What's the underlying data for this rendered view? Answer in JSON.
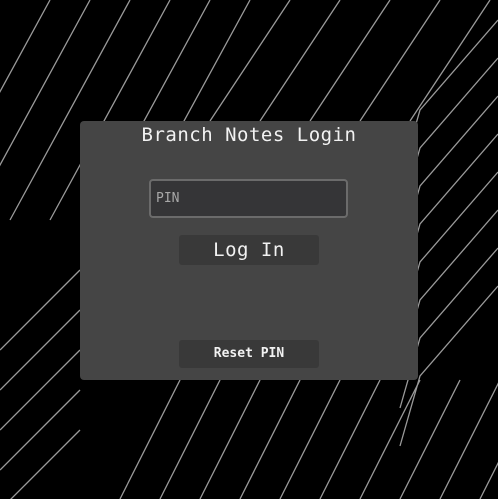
{
  "colors": {
    "background": "#000000",
    "lines": "#9a9a9a",
    "panel": "#454545",
    "button": "#393939",
    "input": "#353537",
    "text": "#f2f2f2"
  },
  "login": {
    "title": "Branch Notes Login",
    "pin_placeholder": "PIN",
    "pin_value": "",
    "login_label": "Log In",
    "reset_label": "Reset PIN"
  }
}
